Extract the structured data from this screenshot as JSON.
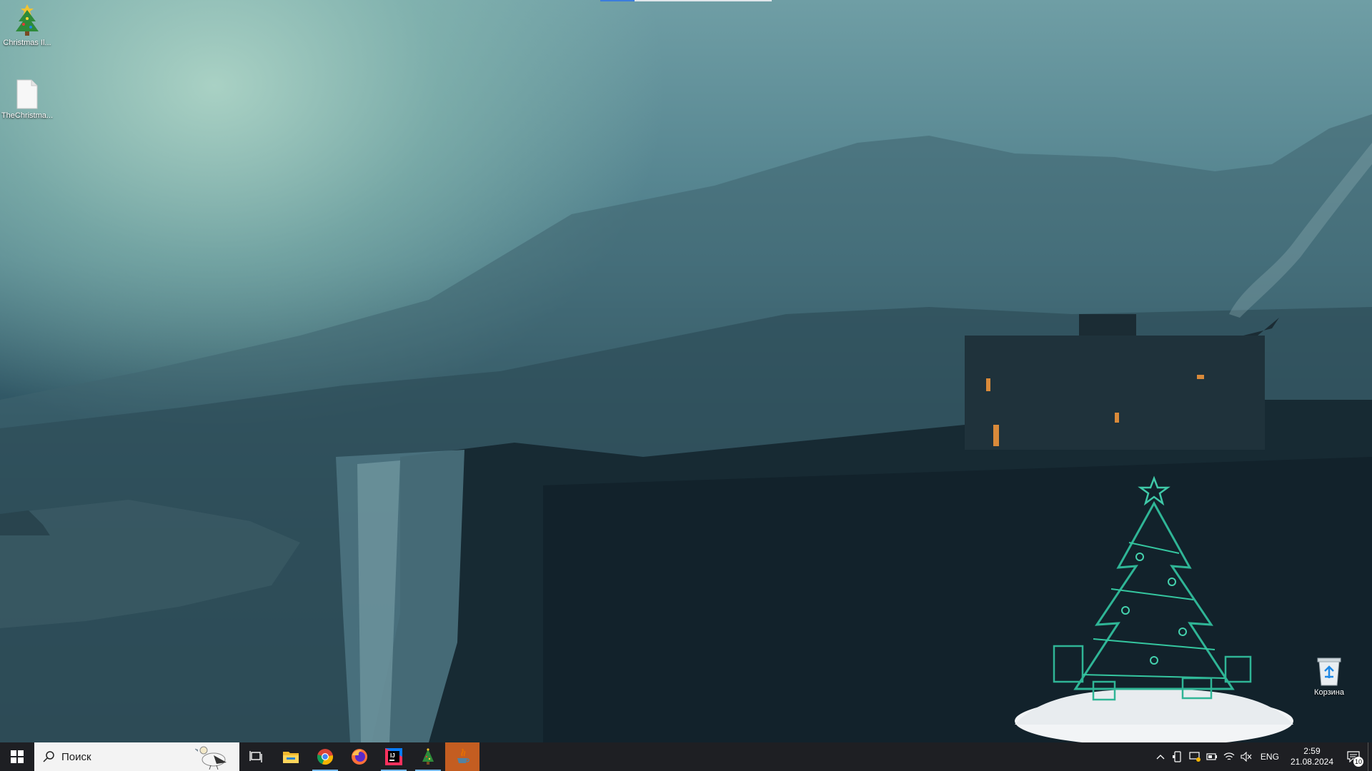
{
  "desktop": {
    "icons": [
      {
        "label": "Christmas Il...",
        "icon": "christmas-tree-icon"
      },
      {
        "label": "TheChristma...",
        "icon": "document-icon"
      },
      {
        "label": "Корзина",
        "icon": "recycle-bin-icon"
      }
    ],
    "widget": {
      "icon": "christmas-tree-widget"
    }
  },
  "taskbar": {
    "search_placeholder": "Поиск",
    "apps": [
      {
        "name": "task-view",
        "icon": "task-view-icon"
      },
      {
        "name": "file-explorer",
        "icon": "folder-icon"
      },
      {
        "name": "chrome",
        "icon": "chrome-icon",
        "active": true
      },
      {
        "name": "firefox",
        "icon": "firefox-icon"
      },
      {
        "name": "intellij",
        "icon": "intellij-icon",
        "active": true
      },
      {
        "name": "christmas-tree-app",
        "icon": "tree-icon",
        "active": true
      },
      {
        "name": "java-app",
        "icon": "java-icon",
        "focused": true
      }
    ],
    "tray": {
      "language": "ENG",
      "time": "2:59",
      "date": "21.08.2024",
      "notification_count": "10"
    }
  },
  "colors": {
    "taskbar_bg": "#1e1f23",
    "active_indicator": "#76b9ed",
    "focused_app_bg": "#c45d21"
  }
}
